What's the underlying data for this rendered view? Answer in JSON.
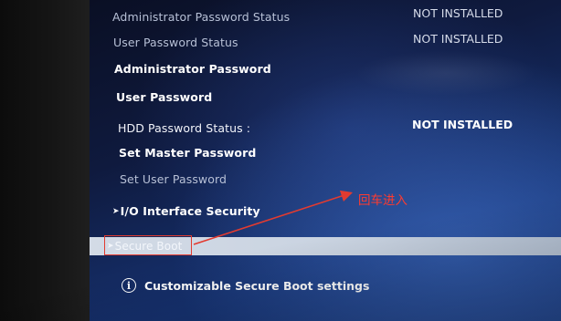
{
  "settings": {
    "admin_password_status_label": "Administrator Password Status",
    "admin_password_status_value": "NOT INSTALLED",
    "user_password_status_label": "User Password Status",
    "user_password_status_value": "NOT INSTALLED",
    "admin_password_label": "Administrator Password",
    "user_password_label": "User Password",
    "hdd_password_status_label": "HDD Password Status :",
    "hdd_password_status_value": "NOT INSTALLED",
    "set_master_password_label": "Set Master Password",
    "set_user_password_label": "Set User Password",
    "io_interface_security_label": "I/O Interface Security",
    "secure_boot_label": "Secure Boot",
    "submenu_marker": "➤"
  },
  "help": {
    "icon": "info-icon",
    "icon_glyph": "i",
    "text": "Customizable Secure Boot settings"
  },
  "annotation": {
    "text": "回车进入",
    "color": "#ff3b2f"
  },
  "colors": {
    "highlight": "#d3dbe6",
    "annotation_red": "#e23b30",
    "screen_blue": "#163271"
  }
}
